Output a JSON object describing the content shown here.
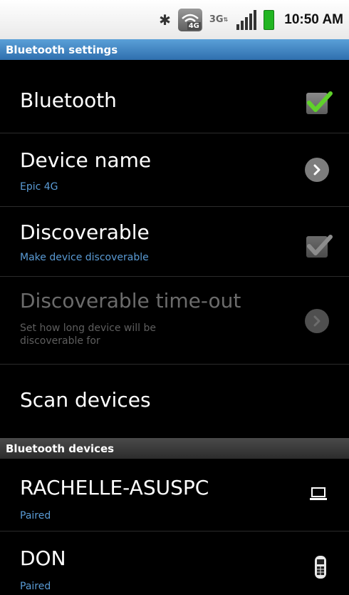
{
  "status_bar": {
    "time": "10:50 AM",
    "network_badge": "4G",
    "network_type": "3G",
    "icons": [
      "bluetooth-icon",
      "wifi-4g-icon",
      "3g-icon",
      "signal-icon",
      "battery-icon"
    ]
  },
  "screen_title": "Bluetooth settings",
  "settings": {
    "bluetooth": {
      "title": "Bluetooth",
      "checked": true
    },
    "device_name": {
      "title": "Device name",
      "summary": "Epic 4G"
    },
    "discoverable": {
      "title": "Discoverable",
      "summary": "Make device discoverable",
      "checked": true,
      "enabled": true
    },
    "discoverable_timeout": {
      "title": "Discoverable time-out",
      "summary": "Set how long device will be discoverable for",
      "enabled": false
    },
    "scan": {
      "title": "Scan devices"
    }
  },
  "devices_header": "Bluetooth devices",
  "devices": [
    {
      "name": "RACHELLE-ASUSPC",
      "status": "Paired",
      "icon": "laptop-icon"
    },
    {
      "name": "DON",
      "status": "Paired",
      "icon": "phone-icon"
    }
  ],
  "colors": {
    "accent_blue": "#5a9bd5",
    "header_blue": "#3b7fc0",
    "check_green": "#5fd12a"
  }
}
